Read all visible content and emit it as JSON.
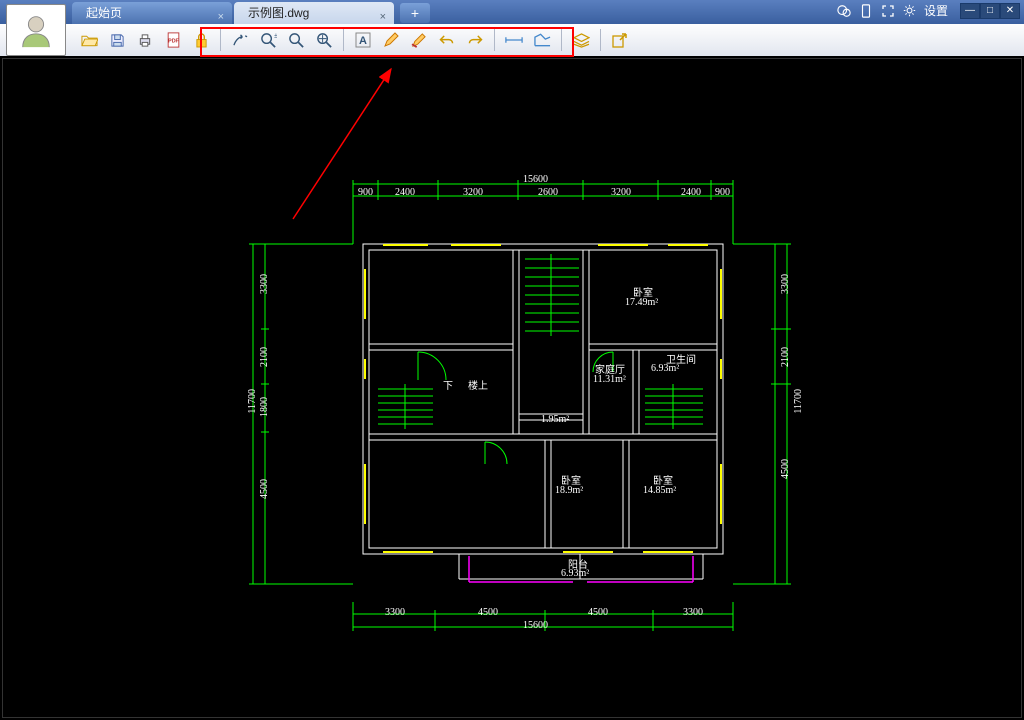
{
  "tabs": [
    {
      "label": "起始页",
      "active": false
    },
    {
      "label": "示例图.dwg",
      "active": true
    }
  ],
  "titlebar": {
    "settings_label": "设置"
  },
  "dims_top_outer": "15600",
  "dims_top": [
    "900",
    "2400",
    "3200",
    "2600",
    "3200",
    "2400",
    "900"
  ],
  "dims_bottom": [
    "3300",
    "4500",
    "4500",
    "3300"
  ],
  "dims_bottom_outer": "15600",
  "dims_left_outer": "11700",
  "dims_left": [
    "3300",
    "2100",
    "1800",
    "4500"
  ],
  "dims_right_outer": "11700",
  "dims_right": [
    "3300",
    "2100",
    "4500"
  ],
  "rooms": {
    "bedroom_tr": {
      "name": "卧室",
      "area": "17.49m²"
    },
    "family": {
      "name": "家庭厅",
      "area": "11.31m²"
    },
    "bath": {
      "name": "卫生间",
      "area": "6.93m²"
    },
    "stair_down": "下",
    "stair_up": "楼上",
    "small": "1.95m²",
    "bedroom_bl": {
      "name": "卧室",
      "area": "18.9m²"
    },
    "bedroom_br": {
      "name": "卧室",
      "area": "14.85m²"
    },
    "balcony": {
      "name": "阳台",
      "area": "6.93m²"
    }
  }
}
